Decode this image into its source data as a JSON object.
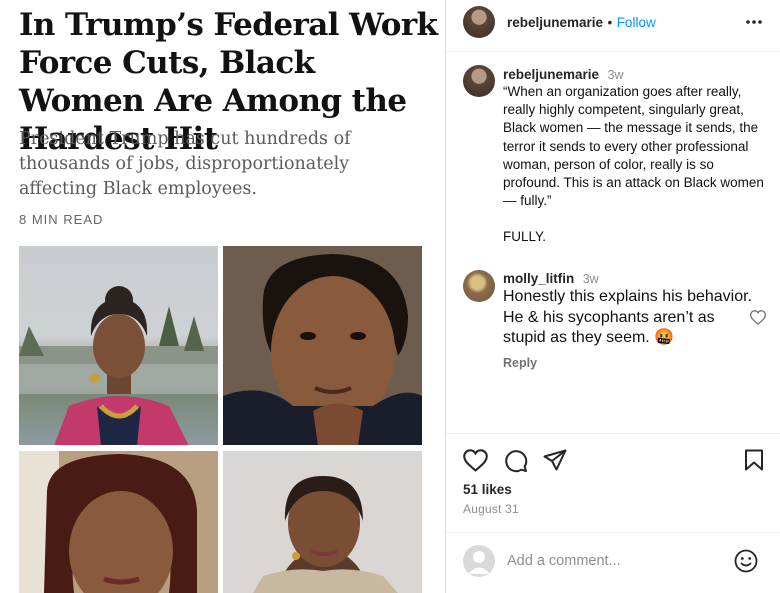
{
  "article": {
    "headline": "In Trump’s Federal Work Force Cuts, Black Women Are Among the Hardest Hit",
    "subhead": "President Trump has cut hundreds of thousands of jobs, disproportionately affecting Black employees.",
    "read_time": "8 MIN READ"
  },
  "post": {
    "owner_username": "rebeljunemarie",
    "separator": "•",
    "follow_label": "Follow",
    "more_icon": "more-options-icon",
    "caption": {
      "username": "rebeljunemarie",
      "timestamp": "3w",
      "paragraph1": "“When an organization goes after really, really highly competent, singularly great, Black women — the message it sends, the terror it sends to every other professional woman, person of color, really is so profound. This is an attack on Black women — fully.”",
      "paragraph2": "FULLY."
    },
    "comment": {
      "username": "molly_litfin",
      "timestamp": "3w",
      "text": "Honestly this explains his behavior. He & his sycophants aren’t as stupid as they seem.",
      "emoji": "🤬",
      "reply_label": "Reply"
    },
    "likes": "51 likes",
    "date": "August 31",
    "add_comment_placeholder": "Add a comment...",
    "colors": {
      "link": "#0095f6",
      "muted": "#8e8e8e",
      "text": "#262626"
    },
    "icons": [
      "heart-icon",
      "comment-icon",
      "share-icon",
      "bookmark-icon",
      "emoji-icon",
      "like-comment-heart-icon"
    ]
  }
}
